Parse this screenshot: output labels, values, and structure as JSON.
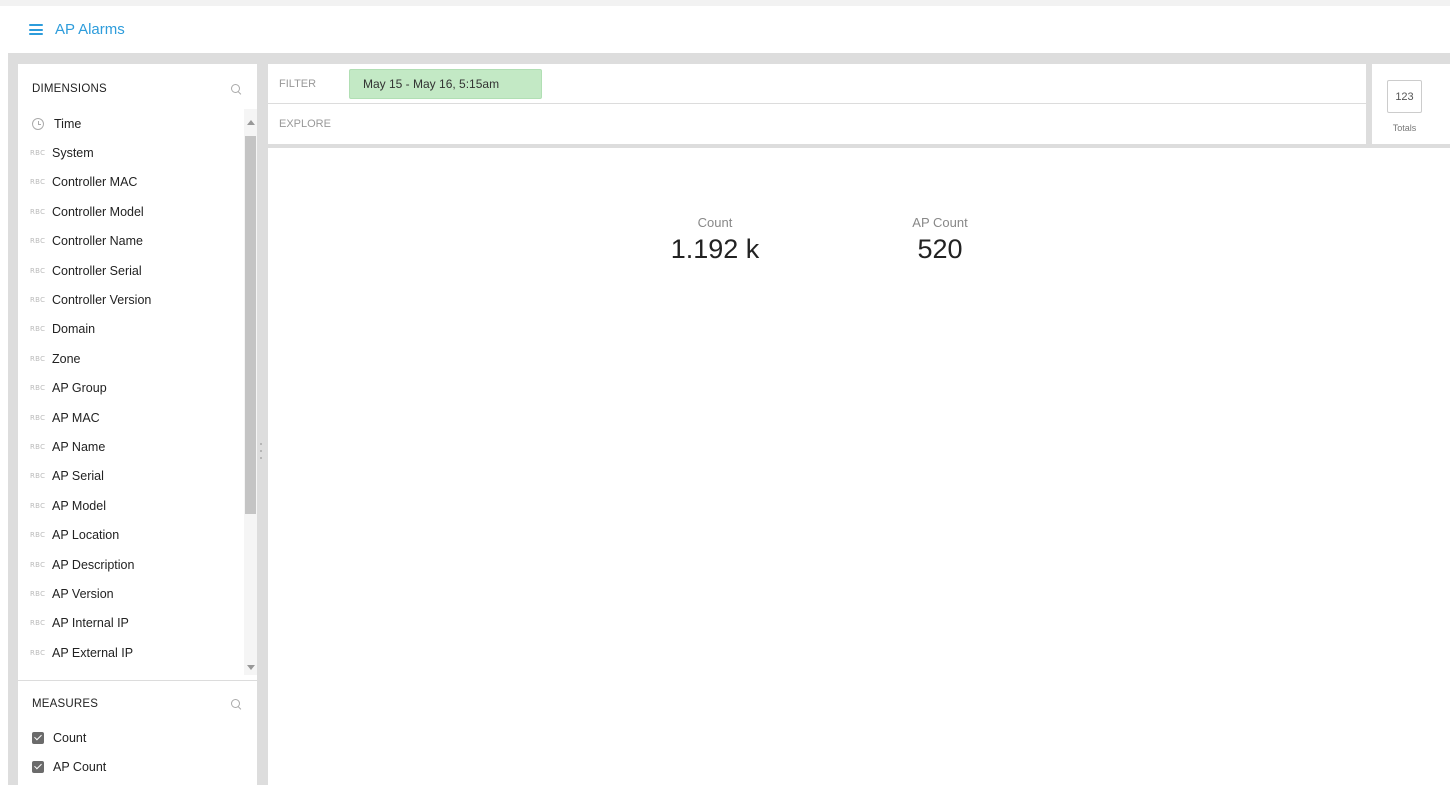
{
  "app": {
    "title": "AP Alarms"
  },
  "dimensions": {
    "title": "DIMENSIONS",
    "items": [
      {
        "type": "time",
        "label": "Time"
      },
      {
        "type": "RBC",
        "label": "System"
      },
      {
        "type": "RBC",
        "label": "Controller MAC"
      },
      {
        "type": "RBC",
        "label": "Controller Model"
      },
      {
        "type": "RBC",
        "label": "Controller Name"
      },
      {
        "type": "RBC",
        "label": "Controller Serial"
      },
      {
        "type": "RBC",
        "label": "Controller Version"
      },
      {
        "type": "RBC",
        "label": "Domain"
      },
      {
        "type": "RBC",
        "label": "Zone"
      },
      {
        "type": "RBC",
        "label": "AP Group"
      },
      {
        "type": "RBC",
        "label": "AP MAC"
      },
      {
        "type": "RBC",
        "label": "AP Name"
      },
      {
        "type": "RBC",
        "label": "AP Serial"
      },
      {
        "type": "RBC",
        "label": "AP Model"
      },
      {
        "type": "RBC",
        "label": "AP Location"
      },
      {
        "type": "RBC",
        "label": "AP Description"
      },
      {
        "type": "RBC",
        "label": "AP Version"
      },
      {
        "type": "RBC",
        "label": "AP Internal IP"
      },
      {
        "type": "RBC",
        "label": "AP External IP"
      }
    ]
  },
  "measures": {
    "title": "MEASURES",
    "items": [
      {
        "label": "Count",
        "checked": true
      },
      {
        "label": "AP Count",
        "checked": true
      }
    ]
  },
  "filter": {
    "label": "FILTER",
    "chip": "May 15 - May 16, 5:15am"
  },
  "explore": {
    "label": "EXPLORE"
  },
  "visualization": {
    "button": "123",
    "label": "Totals"
  },
  "totals": [
    {
      "label": "Count",
      "value": "1.192 k"
    },
    {
      "label": "AP Count",
      "value": "520"
    }
  ],
  "colors": {
    "accent": "#2d9cdb",
    "filter_chip": "#c3e9c5",
    "panel_bg": "#dddddd"
  }
}
